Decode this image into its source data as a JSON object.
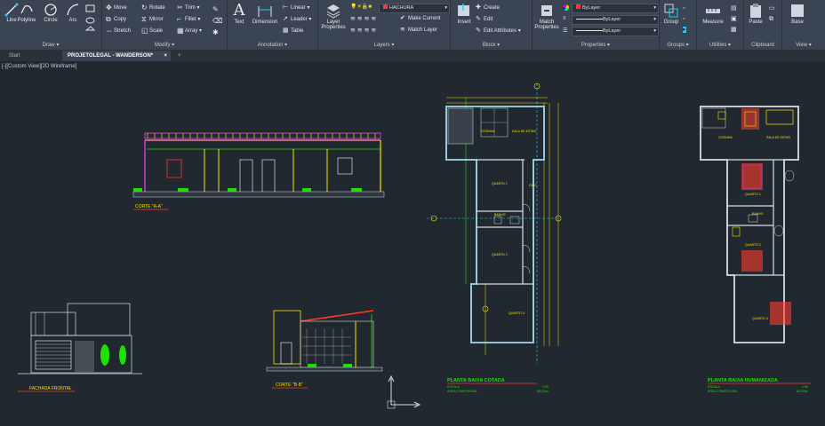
{
  "colors": {
    "ribbon": "#3b4453",
    "canvas": "#212830",
    "cyan": "#19d1ff",
    "yellow": "#f5e300",
    "green": "#1fe000",
    "red": "#ff3a2b",
    "magenta": "#d43ad8",
    "white": "#ffffff"
  },
  "draw": {
    "title": "Draw",
    "line": "Line",
    "polyline": "Polyline",
    "circle": "Circle",
    "arc": "Arc"
  },
  "modify": {
    "title": "Modify",
    "move": "Move",
    "rotate": "Rotate",
    "trim": "Trim",
    "copy": "Copy",
    "mirror": "Mirror",
    "fillet": "Fillet",
    "stretch": "Stretch",
    "scale": "Scale",
    "array": "Array"
  },
  "annotation": {
    "title": "Annotation",
    "text": "Text",
    "dimension": "Dimension",
    "linear": "Linear",
    "leader": "Leader",
    "table": "Table"
  },
  "layers": {
    "title": "Layers",
    "layer_properties": "Layer Properties",
    "current_layer": "HACHURA",
    "make_current": "Make Current",
    "match_layer": "Match Layer"
  },
  "insert": {
    "label": "Insert"
  },
  "block": {
    "title": "Block",
    "create": "Create",
    "edit": "Edit",
    "edit_attributes": "Edit Attributes"
  },
  "properties": {
    "title": "Properties",
    "match_properties": "Match Properties",
    "color": "ByLayer",
    "linetype": "ByLayer",
    "lineweight": "ByLayer"
  },
  "groups": {
    "title": "Groups",
    "group": "Group"
  },
  "utilities": {
    "title": "Utilities",
    "measure": "Measure"
  },
  "clipboard": {
    "title": "Clipboard",
    "paste": "Paste"
  },
  "view": {
    "title": "View",
    "base": "Base"
  },
  "tabs": {
    "start": "Start",
    "active": "PROJETOLEGAL - WANDERSON*",
    "new_tab": "+"
  },
  "viewport": {
    "label": "[-][Custom View][2D Wireframe]"
  },
  "drawing": {
    "section1": "CORTE \"A-A\"",
    "section2": "CORTE \"B-B\"",
    "facade": "FACHADA FRONTAL",
    "plan1_title": "PLANTA BAIXA COTADA",
    "plan2_title": "PLANTA BAIXA HUMANIZADA",
    "scale_label": "ESCALA",
    "scale_value": "1:50",
    "area_label": "AREA CONSTRUIDA",
    "area_value": "66,20m²",
    "rooms": {
      "cozinha": "COZINHA",
      "sala": "SALA DE ESTAR",
      "quarto1": "QUARTO 1",
      "quarto2": "QUARTO 2",
      "quarto3": "QUARTO 3",
      "banheiro": "BANHO",
      "circ": "CIRC."
    }
  }
}
